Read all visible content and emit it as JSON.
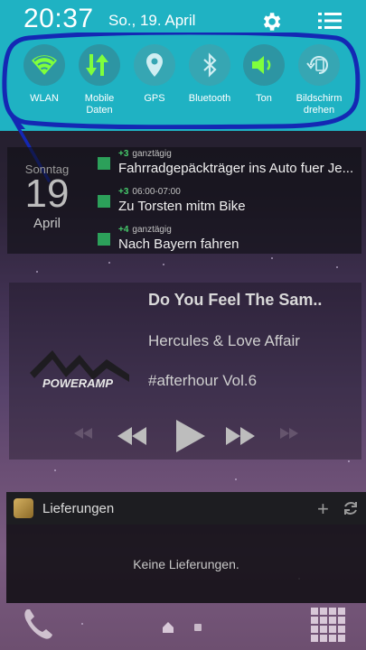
{
  "status_bar": {
    "time": "20:37",
    "date": "So., 19. April"
  },
  "quick_settings": [
    {
      "label": "WLAN",
      "icon": "wifi-icon",
      "on": true
    },
    {
      "label": "Mobile\nDaten",
      "icon": "mobile-data-icon",
      "on": true
    },
    {
      "label": "GPS",
      "icon": "location-icon",
      "on": false
    },
    {
      "label": "Bluetooth",
      "icon": "bluetooth-icon",
      "on": false
    },
    {
      "label": "Ton",
      "icon": "volume-icon",
      "on": true
    },
    {
      "label": "Bildschirm\ndrehen",
      "icon": "screen-rotate-icon",
      "on": false
    }
  ],
  "calendar": {
    "weekday": "Sonntag",
    "day": "19",
    "month": "April",
    "events": [
      {
        "count": "+3",
        "time": "ganztägig",
        "title": "Fahrradgepäckträger ins Auto fuer Je..."
      },
      {
        "count": "+3",
        "time": "06:00-07:00",
        "title": "Zu Torsten mitm Bike"
      },
      {
        "count": "+4",
        "time": "ganztägig",
        "title": "Nach Bayern fahren"
      }
    ]
  },
  "player": {
    "logo_text": "POWERAMP",
    "song": "Do You Feel The Sam..",
    "artist": "Hercules & Love Affair",
    "album": "#afterhour Vol.6"
  },
  "deliveries": {
    "title": "Lieferungen",
    "empty_text": "Keine Lieferungen."
  },
  "colors": {
    "panel": "#1fb2c3",
    "accent_green": "#7fff3c",
    "outline_blue": "#1428b4"
  }
}
